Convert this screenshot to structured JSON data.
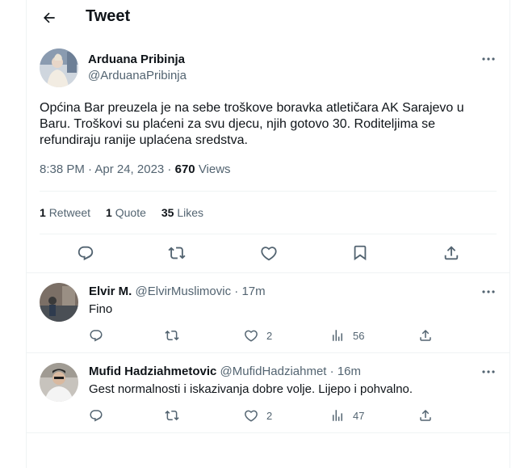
{
  "header": {
    "title": "Tweet",
    "back_icon": "arrow-left-icon"
  },
  "tweet": {
    "author_name": "Arduana Pribinja",
    "author_handle": "@ArduanaPribinja",
    "text": "Općina Bar preuzela je na sebe troškove boravka atletičara AK Sarajevo u Baru. Troškovi su plaćeni za svu djecu, njih gotovo 30. Roditeljima se refundiraju ranije uplaćena sredstva.",
    "time": "8:38 PM · Apr 24, 2023 ·",
    "views_count": "670",
    "views_label": "Views",
    "retweets_count": "1",
    "retweets_label": "Retweet",
    "quotes_count": "1",
    "quotes_label": "Quote",
    "likes_count": "35",
    "likes_label": "Likes",
    "icons": [
      "reply-icon",
      "retweet-icon",
      "like-icon",
      "bookmark-icon",
      "share-icon"
    ]
  },
  "replies": [
    {
      "name": "Elvir M.",
      "handle": "@ElvirMuslimovic",
      "time": "· 17m",
      "text": "Fino",
      "likes": "2",
      "views": "56"
    },
    {
      "name": "Mufid Hadziahmetovic",
      "handle": "@MufidHadziahmet",
      "time": "· 16m",
      "text": "Gest normalnosti i iskazivanja dobre volje. Lijepo i pohvalno.",
      "likes": "2",
      "views": "47"
    }
  ],
  "colors": {
    "text": "#0f1419",
    "secondary": "#536471",
    "border": "#eff3f4"
  }
}
